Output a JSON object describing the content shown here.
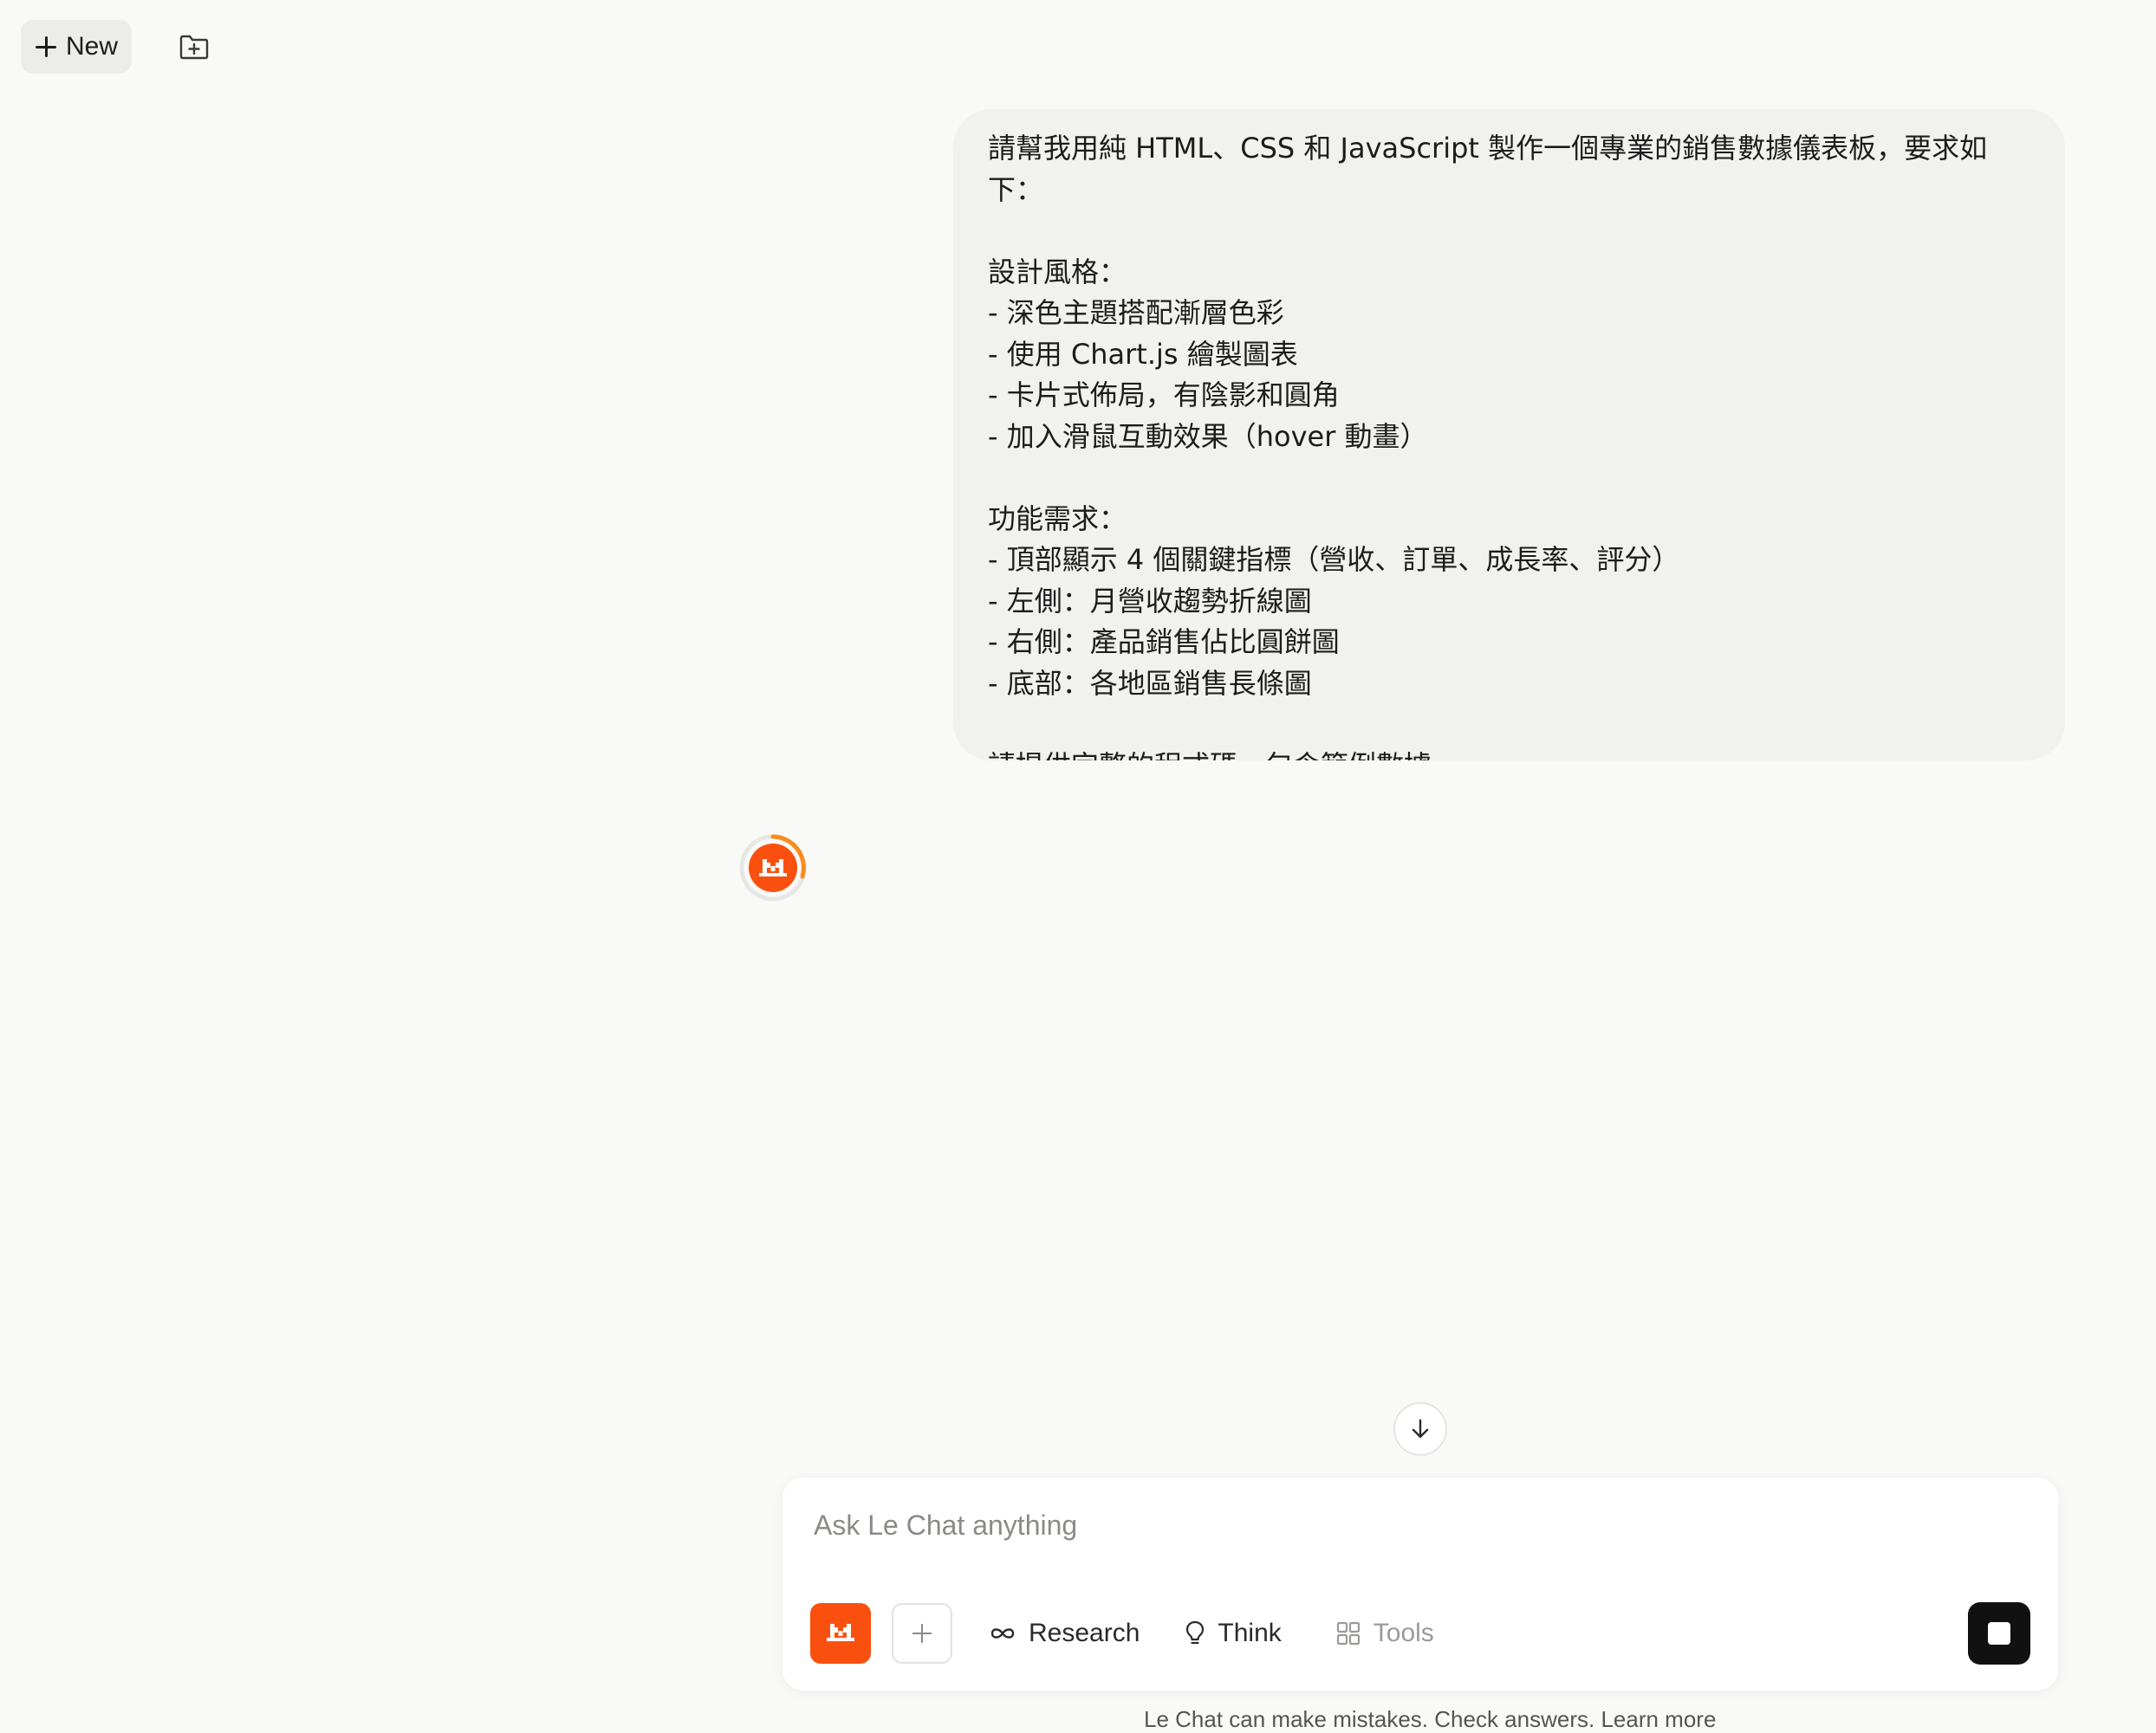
{
  "topbar": {
    "new_label": "New",
    "new_icon": "plus-icon",
    "folder_icon": "folder-plus-icon"
  },
  "conversation": {
    "user_message": "請幫我用純 HTML、CSS 和 JavaScript 製作一個專業的銷售數據儀表板，要求如下：\n\n設計風格：\n- 深色主題搭配漸層色彩\n- 使用 Chart.js 繪製圖表\n- 卡片式佈局，有陰影和圓角\n- 加入滑鼠互動效果（hover 動畫）\n\n功能需求：\n- 頂部顯示 4 個關鍵指標（營收、訂單、成長率、評分）\n- 左側：月營收趨勢折線圖\n- 右側：產品銷售佔比圓餅圖\n- 底部：各地區銷售長條圖\n\n請提供完整的程式碼，包含範例數據。",
    "assistant_status": "loading",
    "assistant_avatar_icon": "mistral-logo-icon"
  },
  "composer": {
    "placeholder": "Ask Le Chat anything",
    "value": "",
    "mistral_icon": "mistral-logo-icon",
    "attach_icon": "plus-icon",
    "research_label": "Research",
    "research_icon": "infinity-icon",
    "think_label": "Think",
    "think_icon": "lightbulb-icon",
    "tools_label": "Tools",
    "tools_icon": "grid-icon",
    "stop_icon": "stop-icon",
    "scroll_icon": "arrow-down-icon"
  },
  "footer": {
    "note": "Le Chat can make mistakes. Check answers. Learn more"
  },
  "colors": {
    "accent": "#fa500f",
    "background": "#f9f9f7",
    "bubble": "#f1f1ef"
  }
}
